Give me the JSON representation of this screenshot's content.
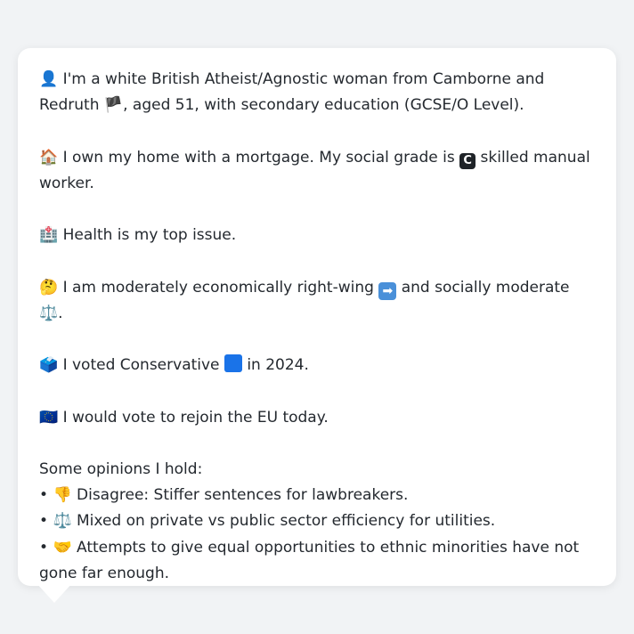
{
  "persona": {
    "intro": {
      "icon": "👤",
      "text_before_flag": "I'm a white British Atheist/Agnostic woman from Camborne and Redruth",
      "flag": "🏴",
      "text_after_flag": ", aged 51, with secondary education (GCSE/O Level)."
    },
    "housing": {
      "icon": "🏠",
      "text_before_badge": "I own my home with a mortgage. My social grade is",
      "badge": "C",
      "text_after_badge": "skilled manual worker."
    },
    "issue": {
      "icon": "🏥",
      "text": "Health is my top issue."
    },
    "ideology": {
      "icon": "🤔",
      "text_before_arrow": "I am moderately economically right-wing",
      "arrow": "➡",
      "text_middle": "and socially moderate",
      "scale_icon": "⚖️",
      "text_end": "."
    },
    "vote": {
      "icon": "🗳️",
      "text_before_square": "I voted Conservative",
      "text_after_square": "in 2024.",
      "party_color": "#1a73e8"
    },
    "eu": {
      "icon": "🇪🇺",
      "text": "I would vote to rejoin the EU today."
    },
    "opinions": {
      "heading": "Some opinions I hold:",
      "items": [
        {
          "bullet": "•",
          "icon": "👎",
          "text": "Disagree: Stiffer sentences for lawbreakers."
        },
        {
          "bullet": "•",
          "icon": "⚖️",
          "text": "Mixed on private vs public sector efficiency for utilities."
        },
        {
          "bullet": "•",
          "icon": "🤝",
          "text": "Attempts to give equal opportunities to ethnic minorities have not gone far enough."
        }
      ]
    }
  }
}
